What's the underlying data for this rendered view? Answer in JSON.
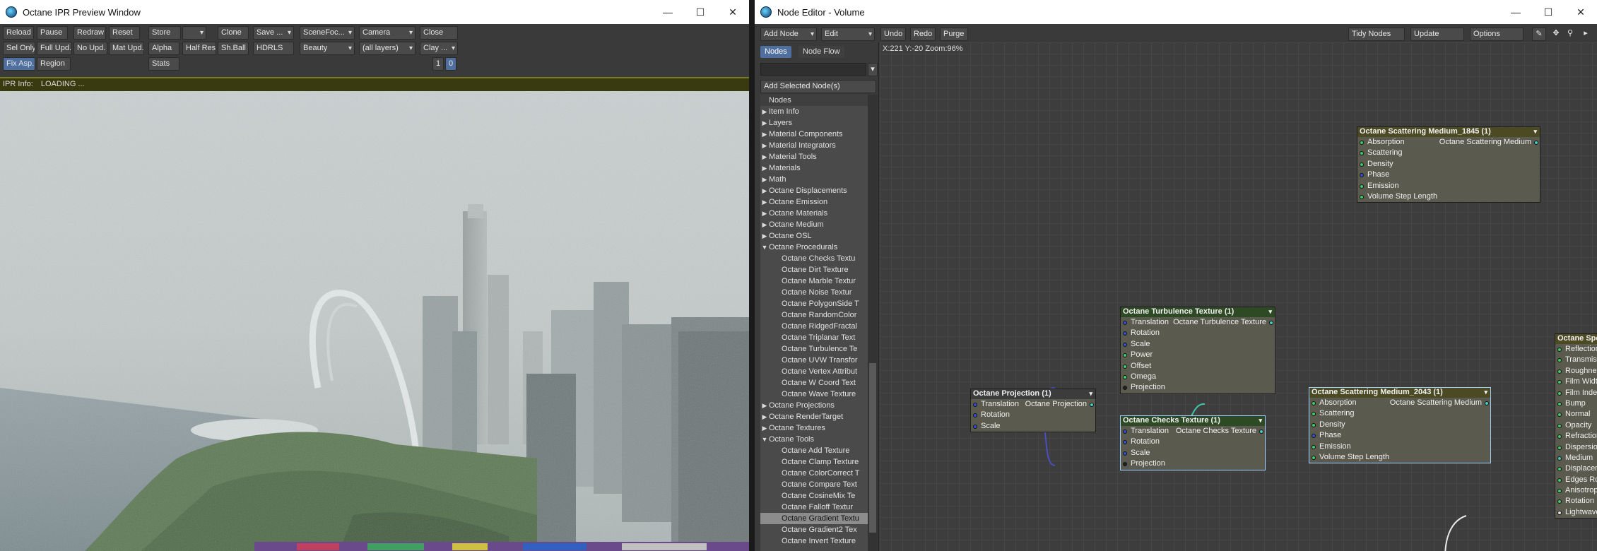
{
  "ipr": {
    "title": "Octane IPR Preview Window",
    "row1": [
      "Reload",
      "Pause",
      "Redraw",
      "Reset",
      "Store",
      "",
      "Clone",
      "Save ...",
      "SceneFoc...",
      "Camera",
      "Close"
    ],
    "row2": [
      "Sel Only",
      "Full Upd.",
      "No Upd.",
      "Mat Upd.",
      "Alpha",
      "Half Res",
      "Sh.Ball",
      "HDRLS",
      "Beauty",
      "(all layers)",
      "Clay ..."
    ],
    "row3": [
      "Fix Asp.",
      "Region",
      "Stats",
      "1",
      "0"
    ],
    "info_label": "IPR Info:",
    "info_value": "LOADING ..."
  },
  "node_editor": {
    "title": "Node Editor - Volume",
    "toolbar": {
      "add_node": "Add Node",
      "edit": "Edit",
      "undo": "Undo",
      "redo": "Redo",
      "purge": "Purge",
      "tidy": "Tidy Nodes",
      "update": "Update",
      "options": "Options"
    },
    "tabs": [
      "Nodes",
      "Node Flow"
    ],
    "add_selected": "Add Selected Node(s)",
    "tree_header": "Nodes",
    "coord_readout": "X:221 Y:-20 Zoom:96%",
    "categories_top": [
      "Item Info",
      "Layers",
      "Material Components",
      "Material Integrators",
      "Material Tools",
      "Materials",
      "Math",
      "Octane Displacements",
      "Octane Emission",
      "Octane Materials",
      "Octane Medium",
      "Octane OSL"
    ],
    "procedurals_label": "Octane Procedurals",
    "procedurals": [
      "Octane Checks Textu",
      "Octane Dirt Texture",
      "Octane Marble Textur",
      "Octane Noise Textur",
      "Octane PolygonSide T",
      "Octane RandomColor",
      "Octane RidgedFractal",
      "Octane Triplanar Text",
      "Octane Turbulence Te",
      "Octane UVW Transfor",
      "Octane Vertex Attribut",
      "Octane W Coord Text",
      "Octane Wave Texture"
    ],
    "categories_mid": [
      "Octane Projections",
      "Octane RenderTarget",
      "Octane Textures"
    ],
    "tools_label": "Octane Tools",
    "tools": [
      "Octane Add Texture",
      "Octane Clamp Texture",
      "Octane ColorCorrect T",
      "Octane Compare Text",
      "Octane CosineMix Te",
      "Octane Falloff Textur",
      "Octane Gradient Textu",
      "Octane Gradient2 Tex",
      "Octane Invert Texture"
    ],
    "nodes": {
      "sm1845": {
        "title": "Octane Scattering Medium_1845 (1)",
        "output": "Octane Scattering Medium",
        "ports": [
          "Absorption",
          "Scattering",
          "Density",
          "Phase",
          "Emission",
          "Volume Step Length"
        ]
      },
      "turb": {
        "title": "Octane Turbulence Texture (1)",
        "output": "Octane Turbulence Texture",
        "ports": [
          "Translation",
          "Rotation",
          "Scale",
          "Power",
          "Offset",
          "Omega",
          "Projection"
        ]
      },
      "proj": {
        "title": "Octane Projection (1)",
        "output": "Octane Projection",
        "ports": [
          "Translation",
          "Rotation",
          "Scale"
        ]
      },
      "checks": {
        "title": "Octane Checks Texture (1)",
        "output": "Octane Checks Texture",
        "ports": [
          "Translation",
          "Rotation",
          "Scale",
          "Projection"
        ]
      },
      "sm2043": {
        "title": "Octane Scattering Medium_2043 (1)",
        "output": "Octane Scattering Medium",
        "ports": [
          "Absorption",
          "Scattering",
          "Density",
          "Phase",
          "Emission",
          "Volume Step Length"
        ]
      },
      "spec": {
        "title": "Octane Specular Material (",
        "output": "O",
        "ports": [
          "Reflection",
          "Transmission",
          "Roughness",
          "Film Width",
          "Film Index",
          "Bump",
          "Normal",
          "Opacity",
          "Refraction Index",
          "Dispersion",
          "Medium",
          "Displacement",
          "Edges Rounding",
          "Anisotropy",
          "Rotation",
          "Lightwave Material"
        ]
      }
    }
  }
}
